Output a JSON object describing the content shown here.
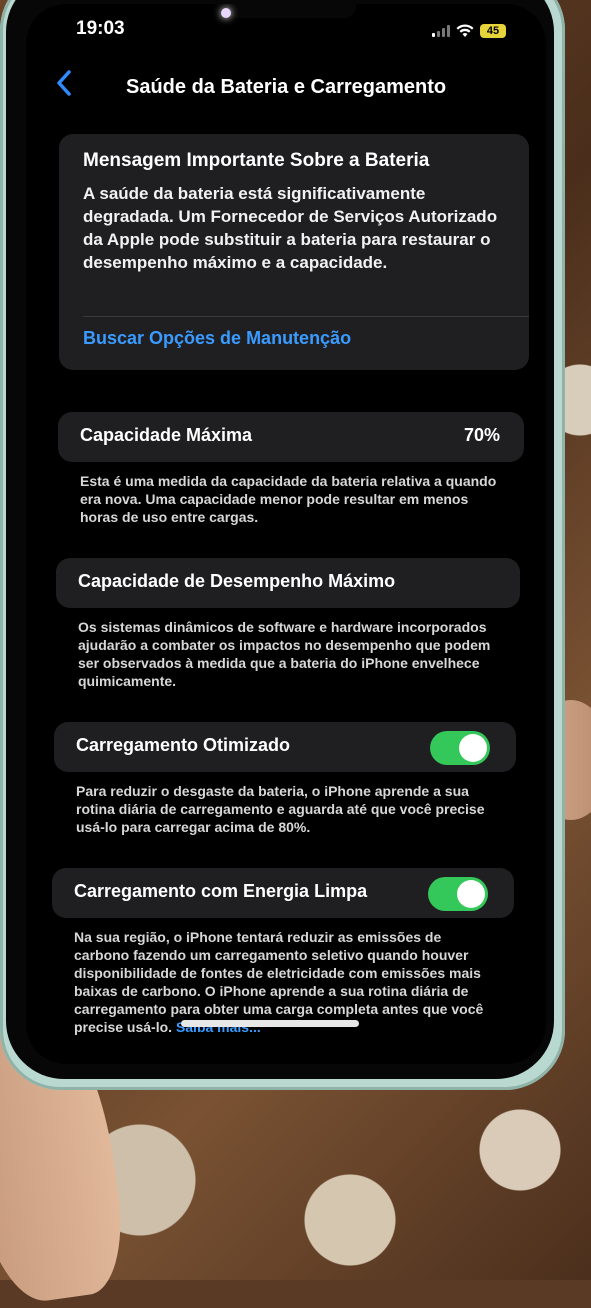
{
  "status_bar": {
    "time": "19:03",
    "battery_level": "45",
    "battery_color": "#e6d43a"
  },
  "nav": {
    "back_icon": "chevron-left-icon",
    "title": "Saúde da Bateria e Carregamento"
  },
  "battery_message": {
    "title": "Mensagem Importante Sobre a Bateria",
    "body": "A saúde da bateria está significativamente degradada. Um Fornecedor de Serviços Autorizado da Apple pode substituir a bateria para restaurar o desempenho máximo e a capacidade.",
    "link": "Buscar Opções de Manutenção"
  },
  "max_capacity": {
    "label": "Capacidade Máxima",
    "value": "70%",
    "note": "Esta é uma medida da capacidade da bateria relativa a quando era nova. Uma capacidade menor pode resultar em menos horas de uso entre cargas."
  },
  "peak_performance": {
    "label": "Capacidade de Desempenho Máximo",
    "note": "Os sistemas dinâmicos de software e hardware incorporados ajudarão a combater os impactos no desempenho que podem ser observados à medida que a bateria do iPhone envelhece quimicamente."
  },
  "optimized_charging": {
    "label": "Carregamento Otimizado",
    "enabled": true,
    "note": "Para reduzir o desgaste da bateria, o iPhone aprende a sua rotina diária de carregamento e aguarda até que você precise usá-lo para carregar acima de 80%."
  },
  "clean_energy": {
    "label": "Carregamento com Energia Limpa",
    "enabled": true,
    "note": "Na sua região, o iPhone tentará reduzir as emissões de carbono fazendo um carregamento seletivo quando houver disponibilidade de fontes de eletricidade com emissões mais baixas de carbono. O iPhone aprende a sua rotina diária de carregamento para obter uma carga completa antes que você precise usá-lo.",
    "link": "Saiba mais..."
  },
  "colors": {
    "accent": "#3a9bff",
    "toggle_on": "#34c759",
    "card_bg": "#1f1f22"
  }
}
